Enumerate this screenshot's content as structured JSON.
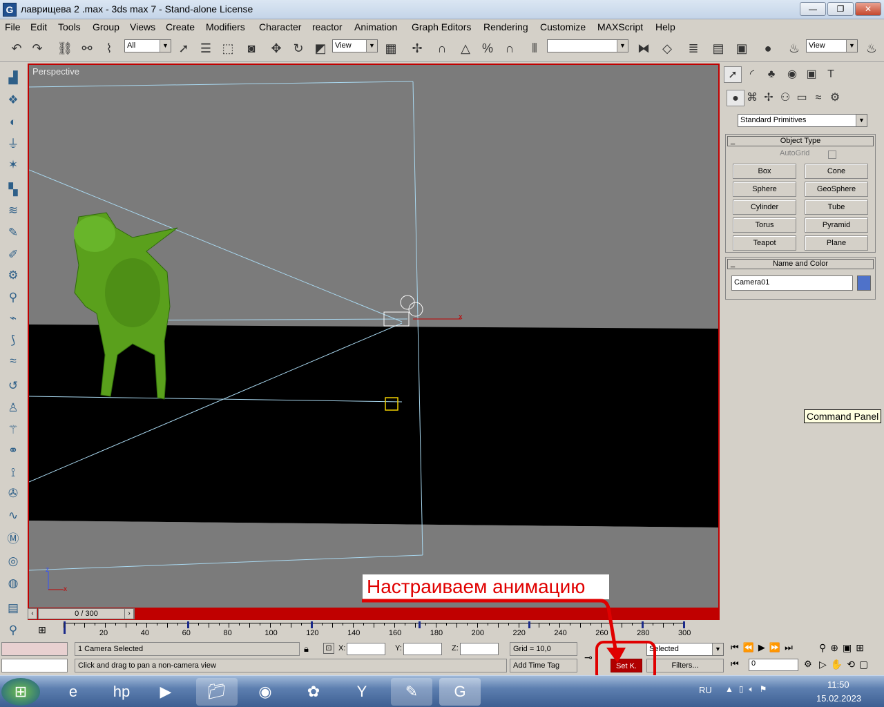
{
  "window": {
    "title": "лаврищева 2 .max - 3ds max 7 - Stand-alone License",
    "logo_icon": "3dsmax-logo-icon",
    "minimize_label": "—",
    "restore_label": "❐",
    "close_label": "✕"
  },
  "menu": [
    "File",
    "Edit",
    "Tools",
    "Group",
    "Views",
    "Create",
    "Modifiers",
    "Character",
    "reactor",
    "Animation",
    "Graph Editors",
    "Rendering",
    "Customize",
    "MAXScript",
    "Help"
  ],
  "toolbar": {
    "selection_filter": "All",
    "ref_coord": "View",
    "named_selection": "",
    "render_view": "View"
  },
  "viewport": {
    "label": "Perspective",
    "axis_x": "x",
    "axis_z": "z"
  },
  "command_panel": {
    "category": "Standard Primitives",
    "object_type_title": "Object Type",
    "autogrid_label": "AutoGrid",
    "buttons": [
      "Box",
      "Cone",
      "Sphere",
      "GeoSphere",
      "Cylinder",
      "Tube",
      "Torus",
      "Pyramid",
      "Teapot",
      "Plane"
    ],
    "name_color_title": "Name and Color",
    "object_name": "Camera01",
    "object_color": "#4f72c9",
    "rollout_toggle": "_"
  },
  "tooltip": "Command Panel",
  "time": {
    "slider_label": "0 / 300",
    "current_frame": 0,
    "total_frames": 300,
    "ticks": [
      "20",
      "40",
      "60",
      "80",
      "100",
      "120",
      "140",
      "160",
      "180",
      "200",
      "220",
      "240",
      "260",
      "280",
      "300"
    ],
    "key_frames": [
      60,
      120,
      172,
      225,
      280,
      300
    ]
  },
  "status": {
    "selection": "1 Camera Selected",
    "prompt": "Click and drag to pan a non-camera view",
    "x_label": "X:",
    "y_label": "Y:",
    "z_label": "Z:",
    "grid": "Grid = 10,0",
    "add_time_tag": "Add Time Tag",
    "key_mode": "Selected",
    "set_key": "Set K.",
    "filters": "Filters...",
    "frame_value": "0"
  },
  "annotation": "Настраиваем анимацию",
  "taskbar": {
    "language": "RU",
    "time": "11:50",
    "date": "15.02.2023"
  },
  "colors": {
    "viewport_border": "#c00000",
    "annotation": "#e00000",
    "ground": "#000000",
    "background": "#7b7b7b",
    "camera_lines": "#a9d8f0",
    "dinosaur": "#5aa01c"
  }
}
